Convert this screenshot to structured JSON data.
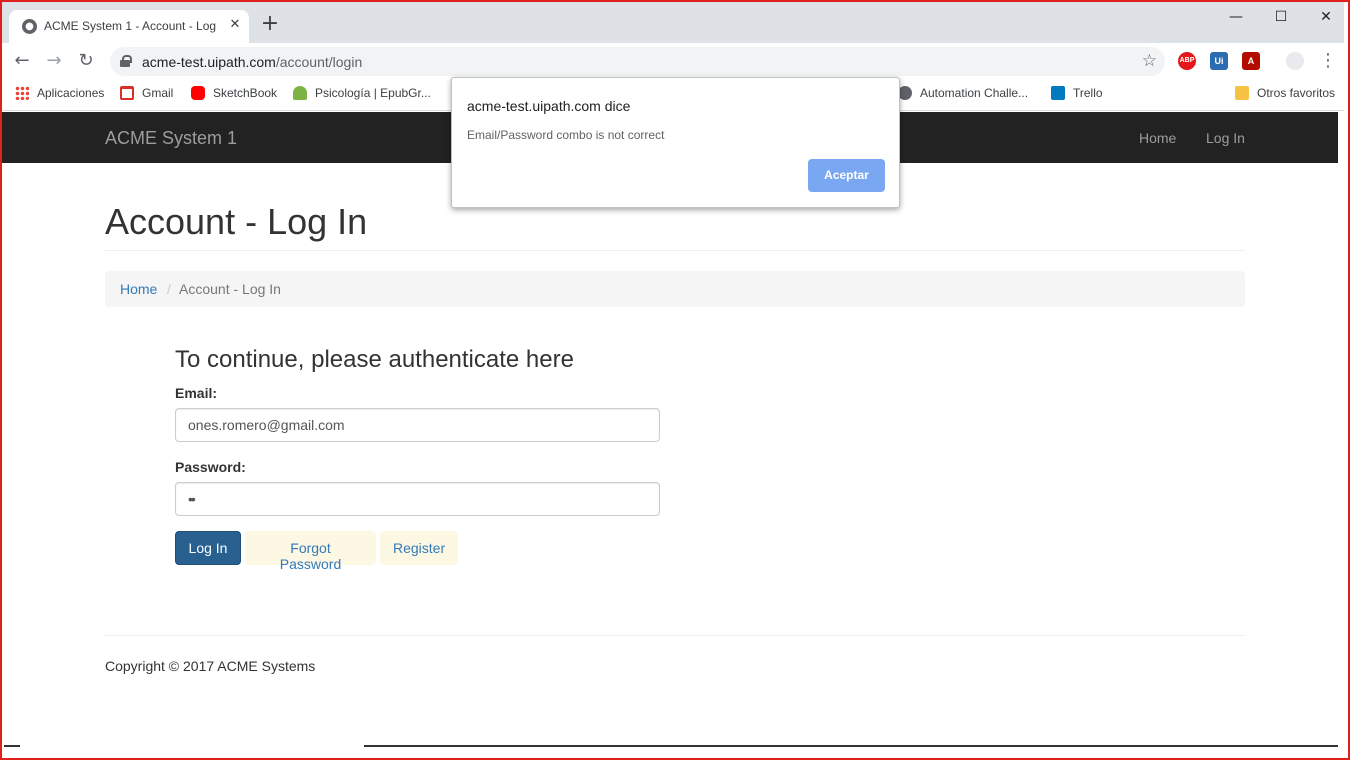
{
  "browser": {
    "tab_title": "ACME System 1 - Account - Log In",
    "tab_close": "✕",
    "new_tab": "+",
    "window_controls": {
      "minimize": "—",
      "maximize": "☐",
      "close": "✕"
    },
    "nav": {
      "back": "←",
      "forward": "→",
      "reload": "↻"
    },
    "url_host": "acme-test.uipath.com",
    "url_path": "/account/login",
    "star": "☆",
    "extensions": [
      {
        "name": "adblock-plus",
        "text": "ABP",
        "color": "#e4181c"
      },
      {
        "name": "uipath",
        "text": "Ui",
        "color": "#2b6cb0"
      },
      {
        "name": "acrobat",
        "text": "A",
        "color": "#b30b00"
      }
    ],
    "menu": "⋮",
    "bookmarks": [
      {
        "label": "Aplicaciones",
        "icon": "apps-grid-icon",
        "color": "#4285f4"
      },
      {
        "label": "Gmail",
        "icon": "gmail-icon",
        "color": "#d93025"
      },
      {
        "label": "SketchBook",
        "icon": "youtube-icon",
        "color": "#ff0000"
      },
      {
        "label": "Psicología | EpubGr...",
        "icon": "epub-icon",
        "color": "#7cb342"
      },
      {
        "label": "Automation Challe...",
        "icon": "globe-icon",
        "color": "#5f6368"
      },
      {
        "label": "Trello",
        "icon": "trello-icon",
        "color": "#0079bf"
      },
      {
        "label": "Otros favoritos",
        "icon": "folder-icon",
        "color": "#f6c343"
      }
    ]
  },
  "site": {
    "brand": "ACME System 1",
    "nav_home": "Home",
    "nav_login": "Log In",
    "page_title": "Account - Log In",
    "breadcrumb_home": "Home",
    "breadcrumb_sep": "/",
    "breadcrumb_current": "Account - Log In",
    "auth_heading": "To continue, please authenticate here",
    "email_label": "Email:",
    "email_value": "ones.romero@gmail.com",
    "password_label": "Password:",
    "password_value": "••",
    "login_button": "Log In",
    "forgot_button": "Forgot Password",
    "register_button": "Register",
    "copyright": "Copyright © 2017 ACME Systems"
  },
  "dialog": {
    "origin": "acme-test.uipath.com dice",
    "message": "Email/Password combo is not correct",
    "ok_label": "Aceptar"
  }
}
